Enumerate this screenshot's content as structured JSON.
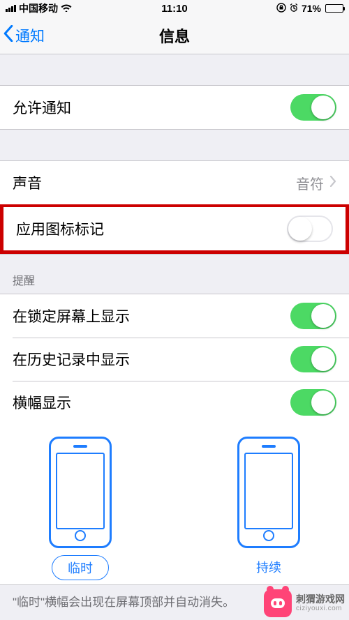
{
  "status": {
    "carrier": "中国移动",
    "time": "11:10",
    "battery_pct": "71%"
  },
  "nav": {
    "back_label": "通知",
    "title": "信息"
  },
  "cells": {
    "allow_notifications": "允许通知",
    "sounds": "声音",
    "sounds_value": "音符",
    "badge_app_icon": "应用图标标记",
    "alerts_header": "提醒",
    "show_on_lock": "在锁定屏幕上显示",
    "show_in_history": "在历史记录中显示",
    "show_banners": "横幅显示"
  },
  "banner_style": {
    "temporary": "临时",
    "persistent": "持续"
  },
  "footer_hint": "\"临时\"横幅会出现在屏幕顶部并自动消失。",
  "watermark": {
    "name": "刺猬游戏网",
    "url": "ciziyouxi.com"
  }
}
